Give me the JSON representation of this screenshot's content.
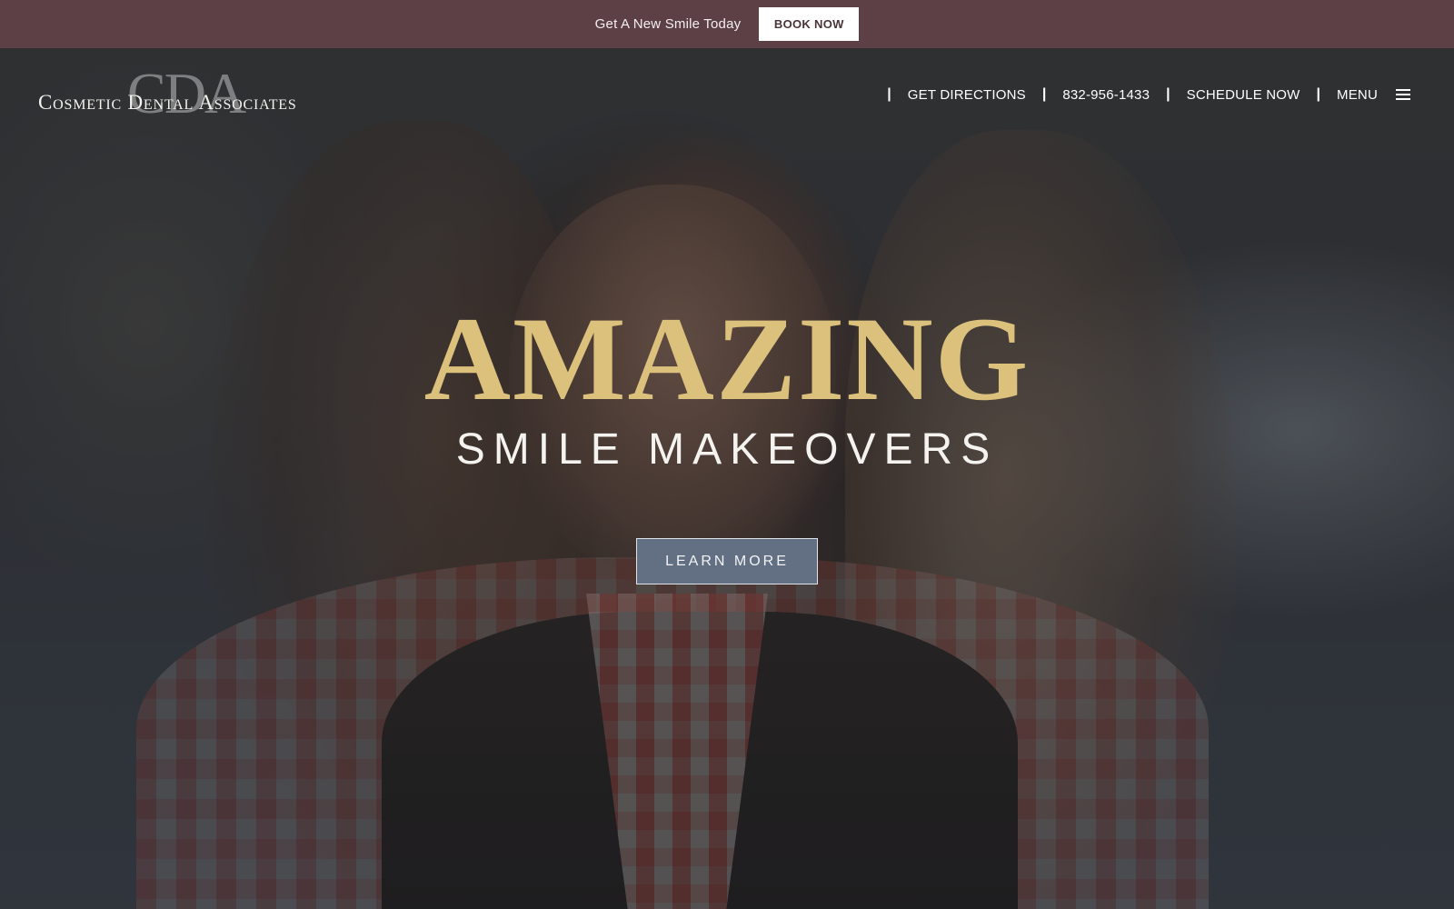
{
  "promo": {
    "text": "Get A New Smile Today",
    "button_label": "BOOK NOW"
  },
  "header": {
    "logo_monogram": "CDA",
    "logo_name": "Cosmetic Dental Associates",
    "nav": {
      "separator": "|",
      "directions_label": "GET DIRECTIONS",
      "phone_label": "832-956-1433",
      "schedule_label": "SCHEDULE NOW",
      "menu_label": "MENU",
      "menu_icon": "hamburger-icon"
    }
  },
  "hero": {
    "heading": "AMAZING",
    "subheading": "SMILE MAKEOVERS",
    "cta_label": "LEARN MORE",
    "background_image": "smiling woman with long brown hair in plaid shirt and dark vest"
  },
  "colors": {
    "promo_bar": "#5c4045",
    "heading_gold": "#dcc17c",
    "cta_button": "#637083",
    "white": "#ffffff"
  }
}
